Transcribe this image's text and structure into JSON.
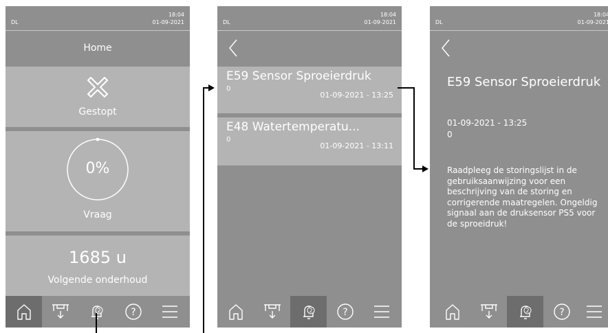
{
  "status": {
    "left": "DL",
    "time": "18:04",
    "date": "01-09-2021"
  },
  "home": {
    "title": "Home",
    "state_label": "Gestopt",
    "demand_value": "0%",
    "demand_label": "Vraag",
    "service_hours": "1685 u",
    "service_label": "Volgende onderhoud"
  },
  "nav": {
    "alarm_count": "2",
    "help_glyph": "?"
  },
  "alarms": [
    {
      "code_title": "E59 Sensor Sproeierdruk",
      "value": "0",
      "datetime": "01-09-2021 - 13:25"
    },
    {
      "code_title": "E48 Watertemperatu...",
      "value": "0",
      "datetime": "01-09-2021 - 13:11"
    }
  ],
  "detail": {
    "title": "E59 Sensor Sproeierdruk",
    "datetime": "01-09-2021 - 13:25",
    "value": "0",
    "description": "Raadpleeg de storingslijst in de gebruiksaanwijzing voor een beschrijving van de storing en corrigerende maatregelen. Ongeldig signaal aan de druksensor PS5 voor de sproeidruk!"
  },
  "colors": {
    "background": "#8f8f8f",
    "tile": "#b4b4b4",
    "active_nav": "#6d6d6d",
    "text": "#ffffff"
  },
  "demand_fraction": 0
}
